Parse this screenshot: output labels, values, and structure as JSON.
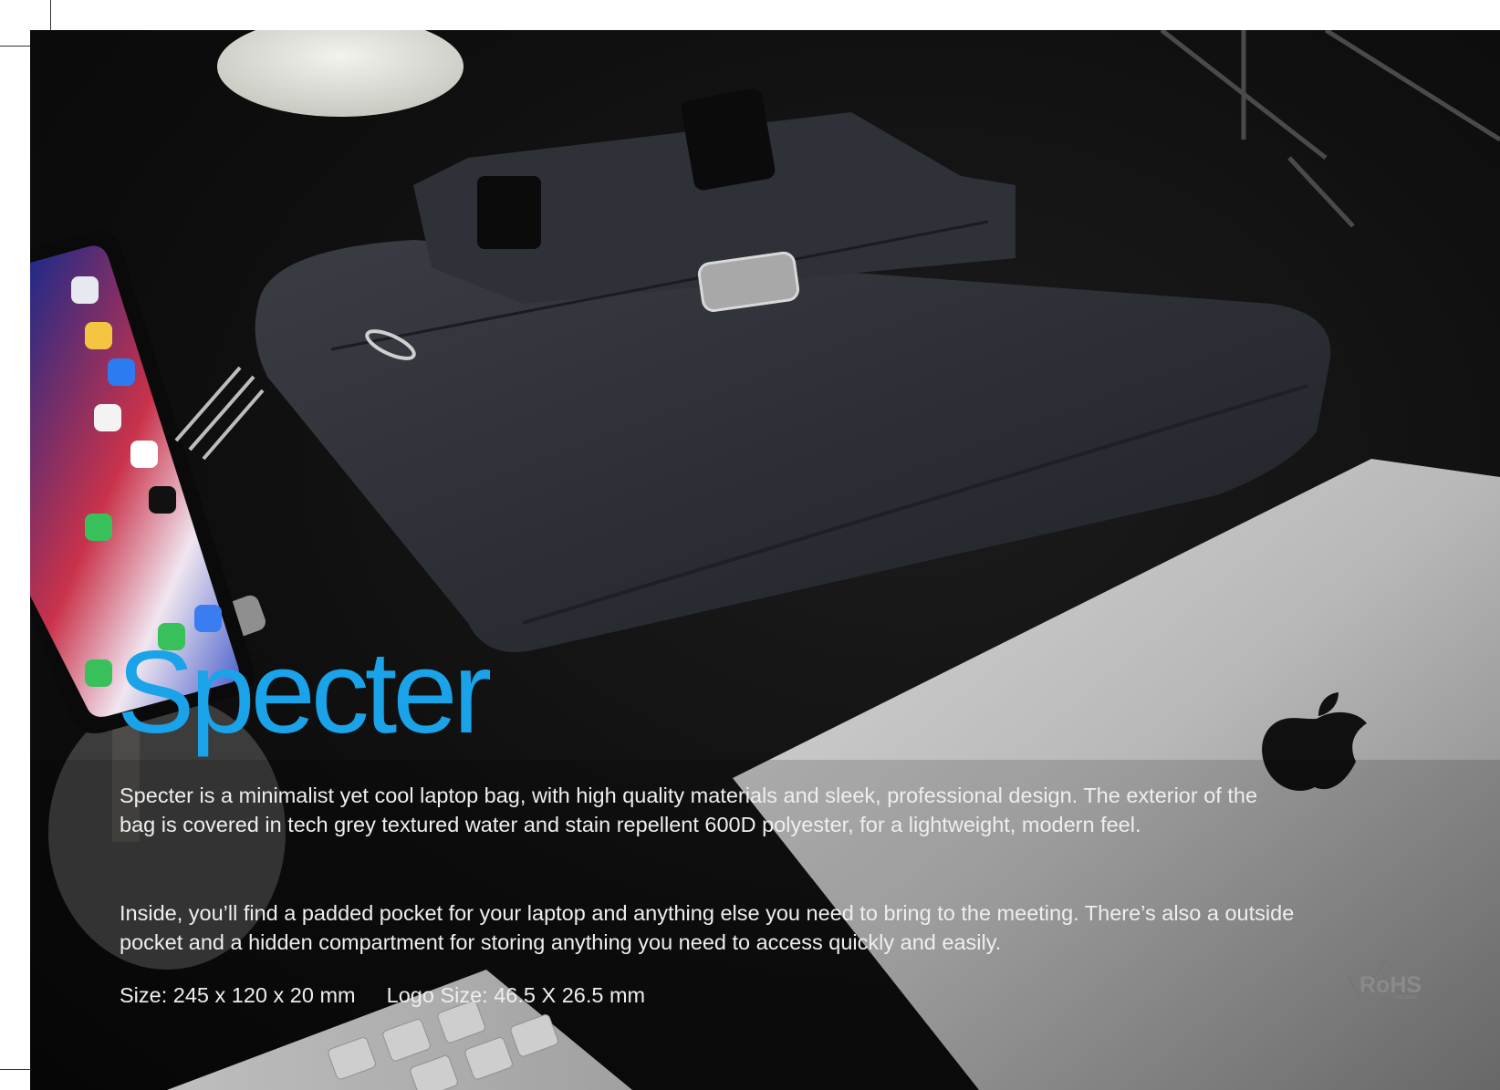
{
  "product": {
    "title": "Specter",
    "paragraph_1": "Specter is a minimalist yet cool laptop bag, with high quality materials and sleek, professional design. The exterior of the bag is covered in tech grey textured water and stain repellent 600D polyester, for a lightweight, modern feel.",
    "paragraph_2": "Inside, you’ll find a padded pocket for your laptop and anything else you need to bring to the meeting. There’s also a outside pocket and a hidden compartment for storing anything you need to access quickly and easily.",
    "size": "Size: 245 x 120 x 20 mm",
    "logo_size": "Logo Size: 46.5 X 26.5 mm"
  },
  "badge": {
    "label": "RoHS",
    "sub": "2002/95/EC"
  },
  "colors": {
    "title": "#1aa3e8",
    "text": "#eeeeee",
    "background": "#0e0e0e"
  }
}
